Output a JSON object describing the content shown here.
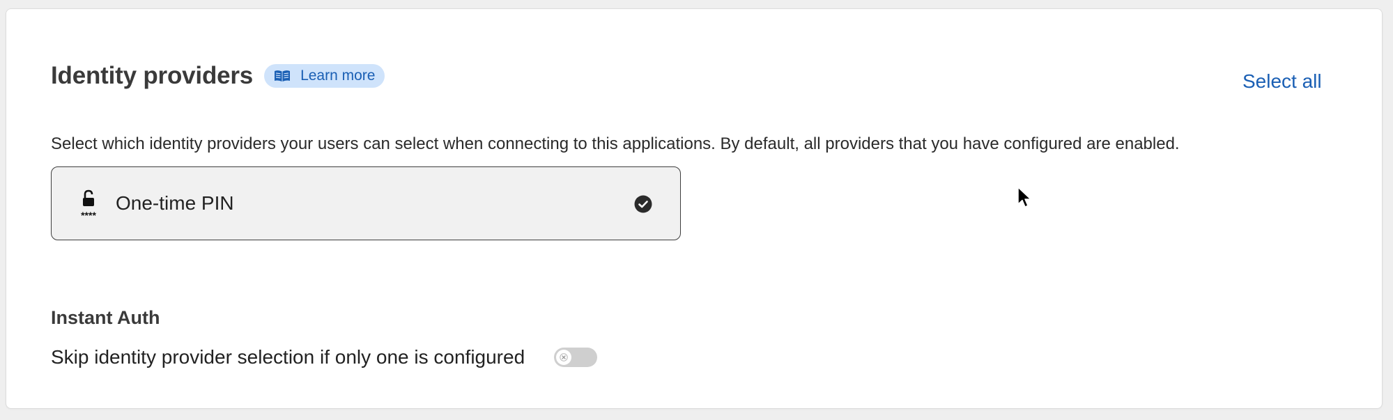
{
  "section": {
    "title": "Identity providers",
    "learn_more_label": "Learn more",
    "select_all_label": "Select all",
    "description": "Select which identity providers your users can select when connecting to this applications. By default, all providers that you have configured are enabled."
  },
  "providers": [
    {
      "label": "One-time PIN",
      "icon": "unlock-pin-icon",
      "icon_caption": "****",
      "selected": true
    }
  ],
  "instant_auth": {
    "heading": "Instant Auth",
    "toggle_label": "Skip identity provider selection if only one is configured",
    "enabled": false
  },
  "colors": {
    "accent": "#1a5fb4",
    "badge_bg": "#cfe3fb",
    "card_bg": "#ffffff",
    "page_bg": "#efefef",
    "provider_bg": "#f1f1f1",
    "toggle_off": "#cfcfcf"
  },
  "icons": {
    "learn_more": "book-icon",
    "provider_check": "check-circle-icon",
    "toggle_knob": "close-icon"
  }
}
